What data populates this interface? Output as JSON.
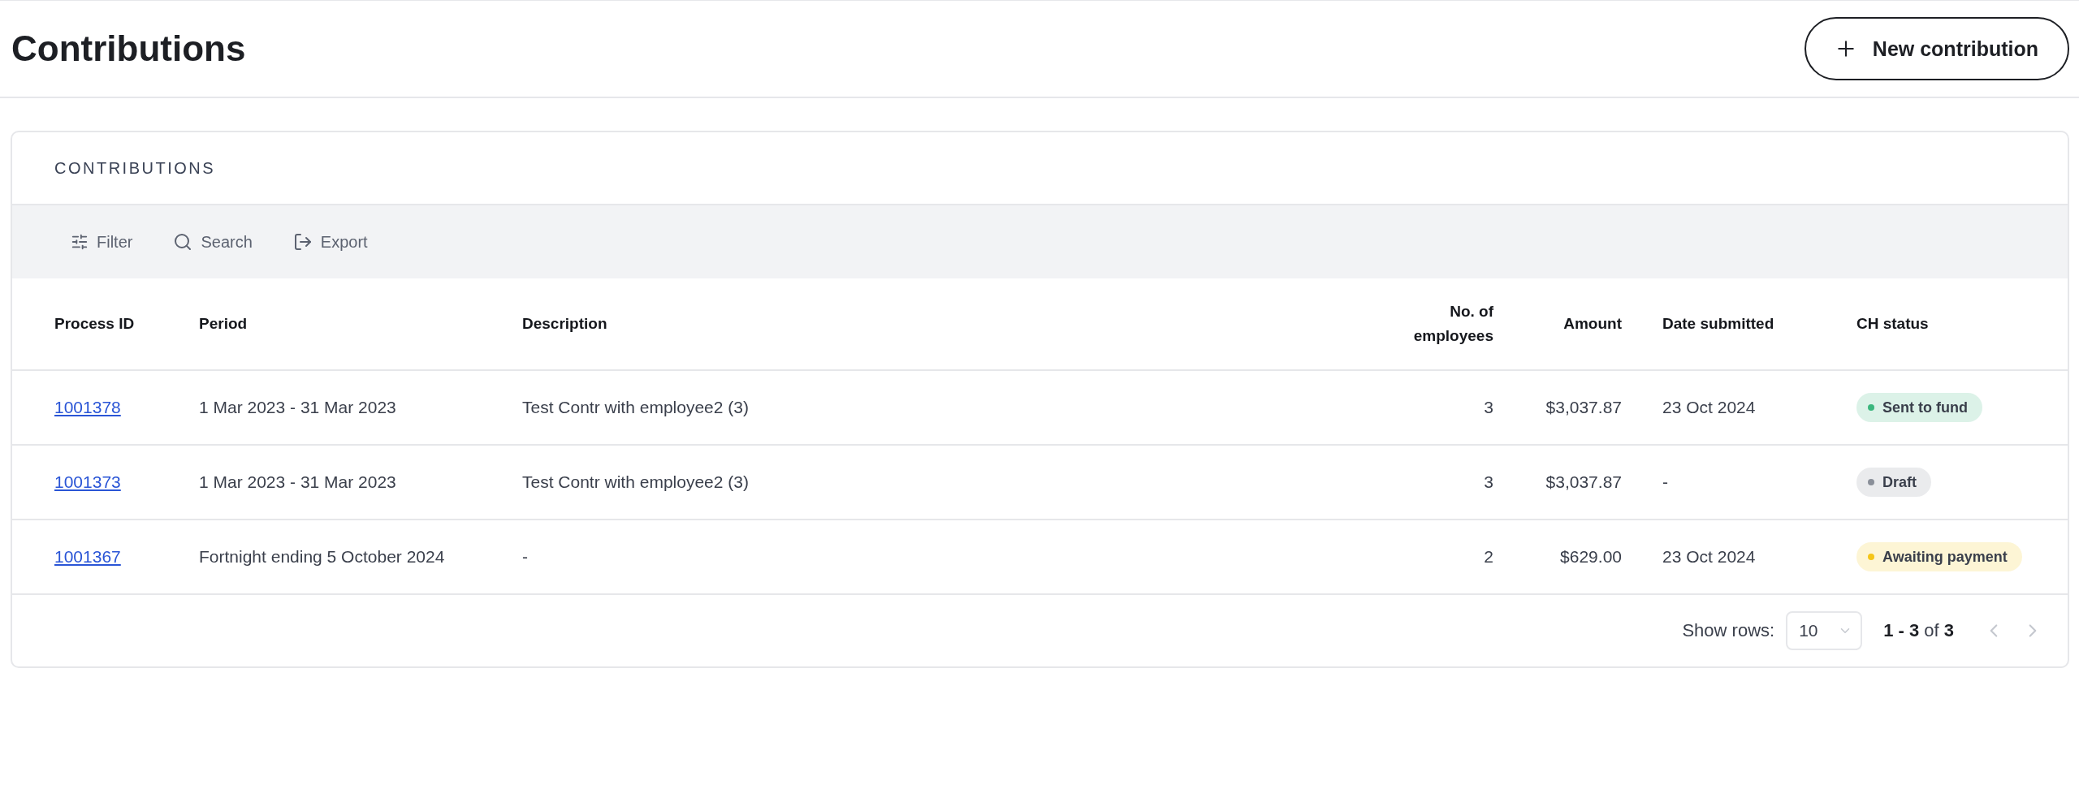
{
  "page": {
    "title": "Contributions",
    "new_button": "New contribution"
  },
  "card": {
    "title": "CONTRIBUTIONS",
    "toolbar": [
      {
        "kind": "filter",
        "label": "Filter"
      },
      {
        "kind": "search",
        "label": "Search"
      },
      {
        "kind": "export",
        "label": "Export"
      }
    ],
    "table": {
      "columns": [
        "Process ID",
        "Period",
        "Description",
        "No. of employees",
        "Amount",
        "Date submitted",
        "CH status"
      ],
      "rows": [
        {
          "process_id": "1001378",
          "period": "1 Mar 2023 - 31 Mar 2023",
          "description": "Test Contr with employee2 (3)",
          "employees": "3",
          "amount": "$3,037.87",
          "date_submitted": "23 Oct 2024",
          "status": {
            "label": "Sent to fund",
            "color": "#3bb77e"
          }
        },
        {
          "process_id": "1001373",
          "period": "1 Mar 2023 - 31 Mar 2023",
          "description": "Test Contr with employee2 (3)",
          "employees": "3",
          "amount": "$3,037.87",
          "date_submitted": "-",
          "status": {
            "label": "Draft",
            "color": "#8a8f99"
          }
        },
        {
          "process_id": "1001367",
          "period": "Fortnight ending 5 October 2024",
          "description": "-",
          "employees": "2",
          "amount": "$629.00",
          "date_submitted": "23 Oct 2024",
          "status": {
            "label": "Awaiting payment",
            "color": "#f5c518"
          }
        }
      ]
    },
    "footer": {
      "show_rows_label": "Show rows:",
      "rows_value": "10",
      "range": "**1 - 3** of **3**",
      "prev_disabled": true,
      "next_disabled": true
    }
  }
}
